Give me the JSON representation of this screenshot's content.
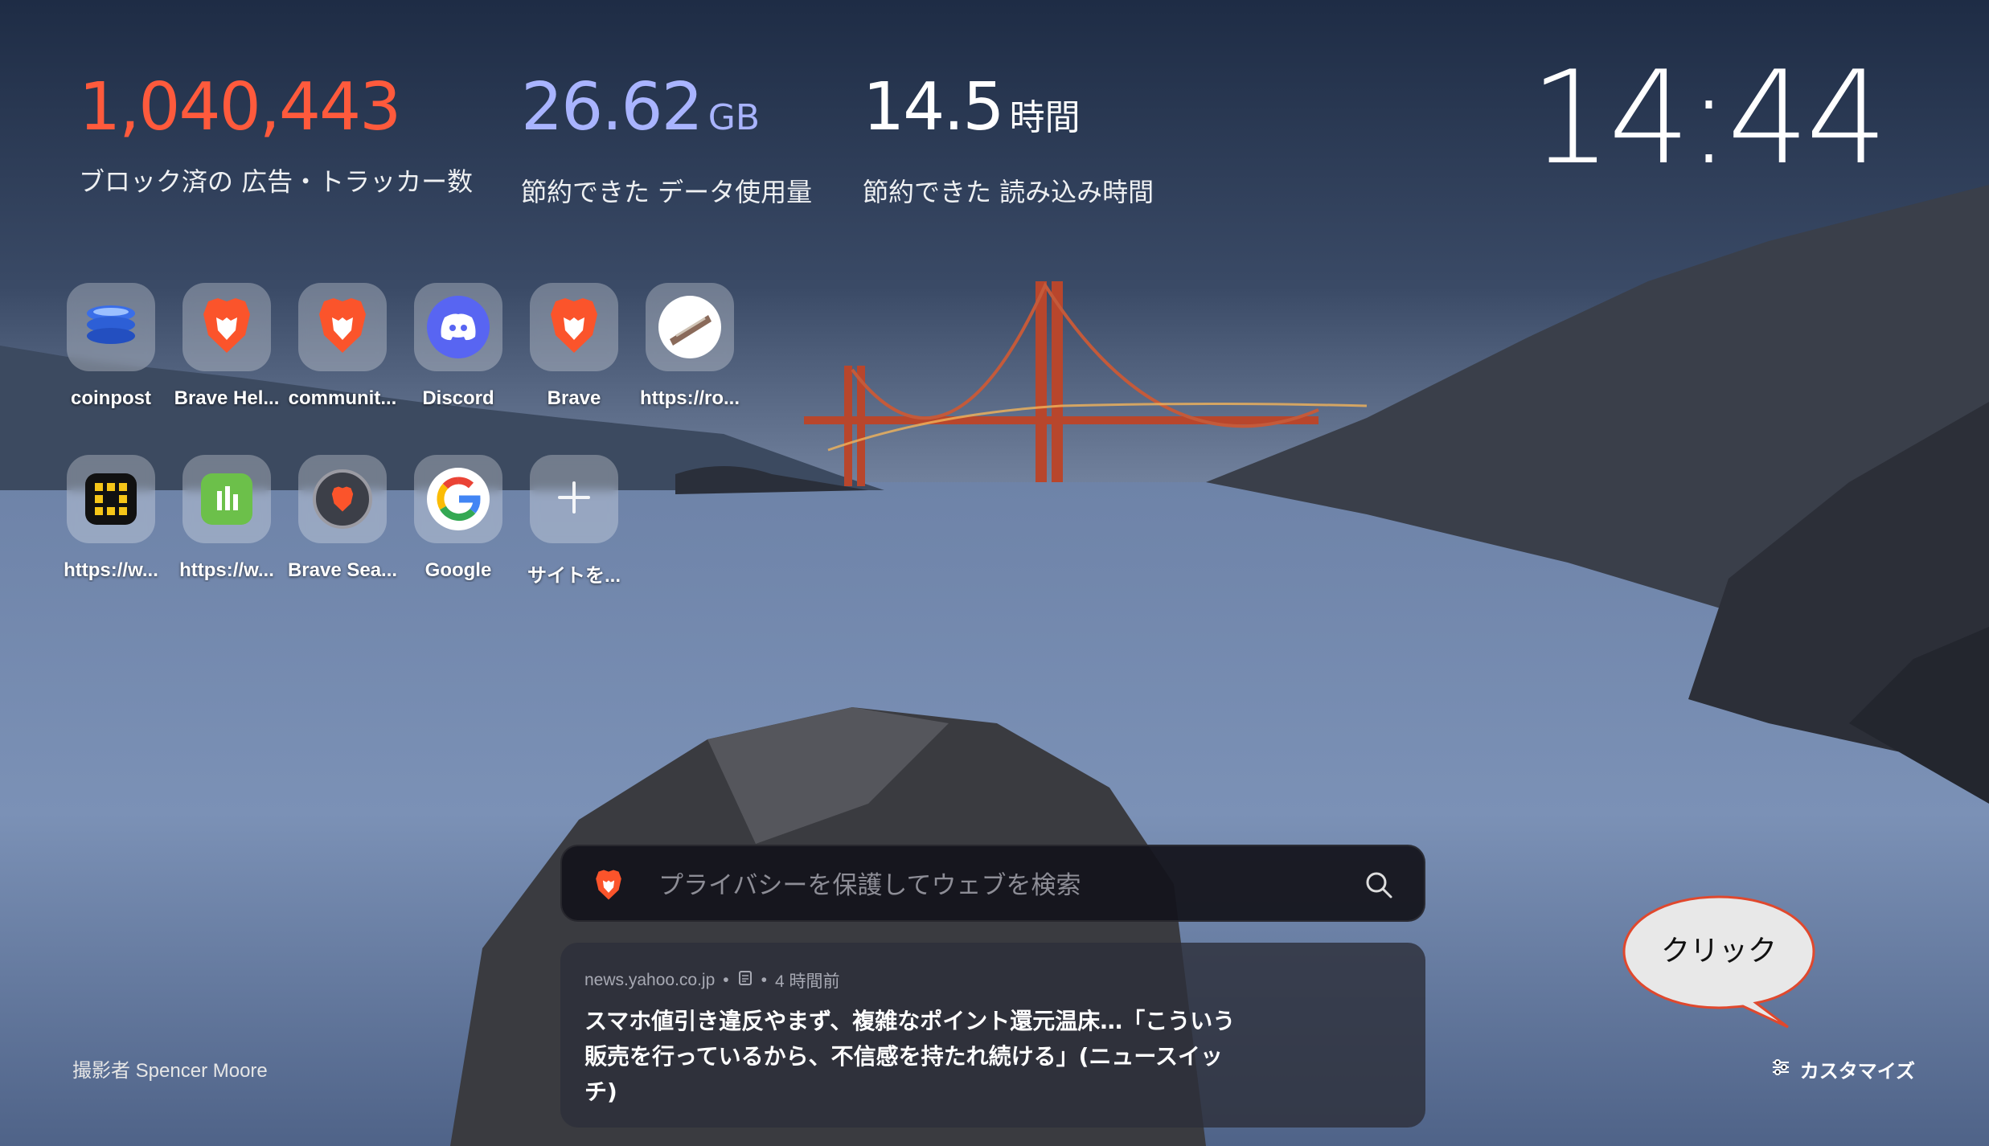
{
  "stats": {
    "ads": {
      "value": "1,040,443",
      "label": "ブロック済の 広告・トラッカー数"
    },
    "bandwidth": {
      "value": "26.62",
      "unit": "GB",
      "label": "節約できた データ使用量"
    },
    "time": {
      "value": "14.5",
      "unit": "時間",
      "label": "節約できた 読み込み時間"
    }
  },
  "clock": "14:44",
  "top_sites": [
    {
      "name": "coinpost",
      "icon": "coinpost-icon"
    },
    {
      "name": "Brave Hel...",
      "icon": "brave-lion-icon"
    },
    {
      "name": "communit...",
      "icon": "brave-lion-icon"
    },
    {
      "name": "Discord",
      "icon": "discord-icon"
    },
    {
      "name": "Brave",
      "icon": "brave-lion-icon"
    },
    {
      "name": "https://ro...",
      "icon": "site-thumbnail-icon"
    },
    {
      "name": "https://w...",
      "icon": "app-grid-icon"
    },
    {
      "name": "https://w...",
      "icon": "green-app-icon"
    },
    {
      "name": "Brave Sea...",
      "icon": "brave-search-icon"
    },
    {
      "name": "Google",
      "icon": "google-icon"
    },
    {
      "name": "サイトを...",
      "icon": "plus-icon"
    }
  ],
  "search": {
    "placeholder": "プライバシーを保護してウェブを検索"
  },
  "news": {
    "source": "news.yahoo.co.jp",
    "age": "4 時間前",
    "headline": "スマホ値引き違反やまず、複雑なポイント還元温床…「こういう販売を行っているから、不信感を持たれ続ける」(ニュースイッチ)"
  },
  "photo_credit": "撮影者 Spencer Moore",
  "customize_label": "カスタマイズ",
  "callout": "クリック",
  "colors": {
    "ads_stat": "#ff5a3c",
    "bandwidth_stat": "#a9b4ff",
    "brave_orange": "#fb542b"
  }
}
